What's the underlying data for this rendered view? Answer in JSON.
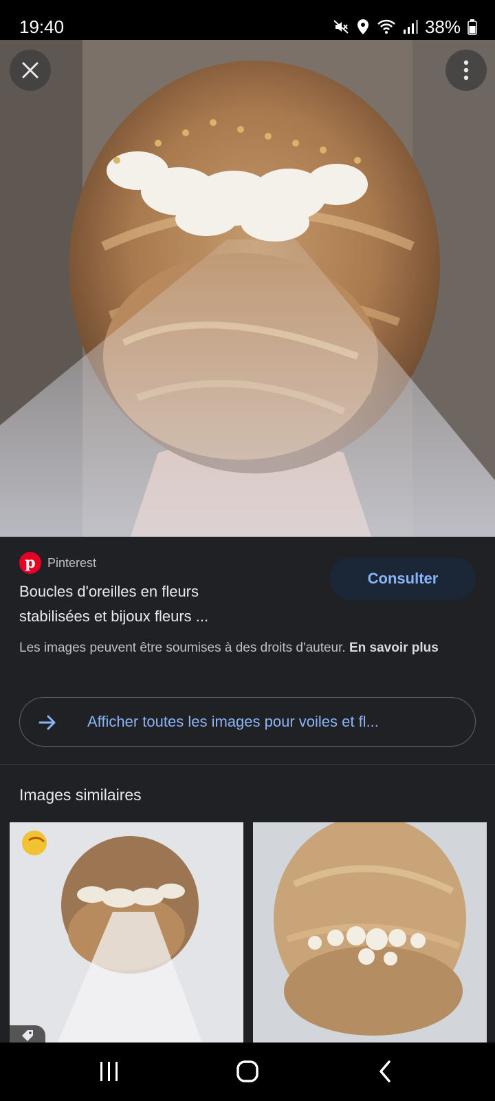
{
  "status_bar": {
    "time": "19:40",
    "battery": "38%",
    "icons": [
      "mute-icon",
      "location-icon",
      "wifi-icon",
      "signal-icon",
      "battery-icon"
    ]
  },
  "viewer": {
    "close_icon": "close-icon",
    "more_icon": "more-vert-icon"
  },
  "result": {
    "source": "Pinterest",
    "source_logo_letter": "p",
    "title_line1": "Boucles d'oreilles en fleurs",
    "title_line2": "stabilisées et bijoux fleurs ...",
    "visit_label": "Consulter",
    "copyright_text": "Les images peuvent être soumises à des droits d'auteur.",
    "learn_more": "En savoir plus"
  },
  "see_all": {
    "label": "Afficher toutes les images pour voiles et fl..."
  },
  "similar": {
    "heading": "Images similaires"
  },
  "colors": {
    "accent": "#8ab4f8",
    "background": "#202124",
    "pinterest": "#e60023",
    "visit_button_bg": "#1b2637"
  },
  "nav_bar": {
    "icons": [
      "recents-icon",
      "home-icon",
      "back-icon"
    ]
  }
}
